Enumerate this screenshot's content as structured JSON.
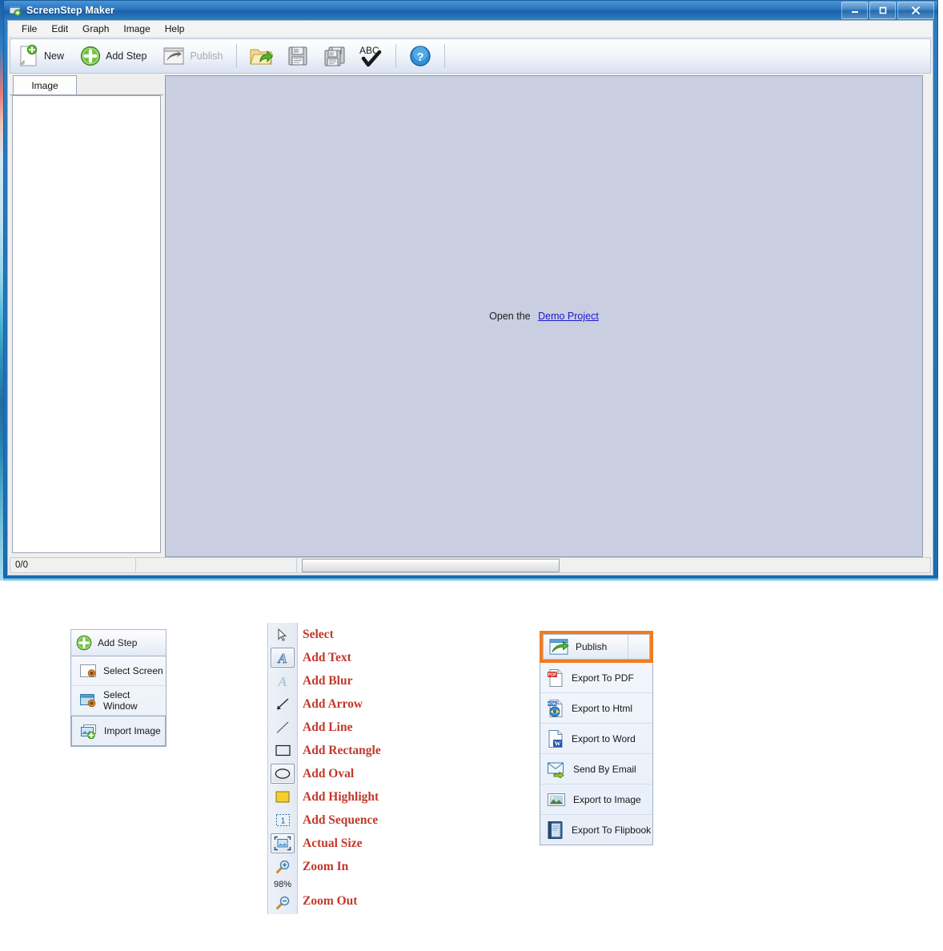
{
  "window": {
    "title": "ScreenStep Maker",
    "icon": "app-window-icon",
    "buttons": {
      "minimize": "–",
      "maximize": "❑",
      "close": "✕"
    }
  },
  "menubar": {
    "items": [
      {
        "label": "File"
      },
      {
        "label": "Edit"
      },
      {
        "label": "Graph"
      },
      {
        "label": "Image"
      },
      {
        "label": "Help"
      }
    ]
  },
  "toolbar": {
    "new_label": "New",
    "add_step_label": "Add Step",
    "publish_label": "Publish",
    "icons": [
      {
        "name": "open-folder-icon"
      },
      {
        "name": "save-icon"
      },
      {
        "name": "save-as-icon"
      },
      {
        "name": "spellcheck-icon",
        "text": "ABC"
      },
      {
        "name": "help-icon",
        "text": "?"
      }
    ]
  },
  "left_pane": {
    "tab_label": "Image"
  },
  "canvas": {
    "message_prefix": "Open the",
    "link_label": "Demo Project"
  },
  "statusbar": {
    "counter": "0/0"
  },
  "callouts": {
    "add_step_menu": {
      "header": "Add Step",
      "header_icon": "green-plus-icon",
      "items": [
        {
          "label": "Select Screen",
          "icon": "select-screen-icon"
        },
        {
          "label": "Select Window",
          "icon": "select-window-icon"
        },
        {
          "label": "Import Image",
          "icon": "import-image-icon"
        }
      ]
    },
    "tools_palette": {
      "zoom_percent": "98%",
      "items": [
        {
          "label": "Select",
          "icon": "cursor-arrow-icon",
          "selected": false
        },
        {
          "label": "Add Text",
          "icon": "text-a-icon",
          "selected": true
        },
        {
          "label": "Add Blur",
          "icon": "blur-a-icon",
          "selected": false
        },
        {
          "label": "Add Arrow",
          "icon": "arrow-icon",
          "selected": false
        },
        {
          "label": "Add Line",
          "icon": "line-icon",
          "selected": false
        },
        {
          "label": "Add Rectangle",
          "icon": "rectangle-icon",
          "selected": false
        },
        {
          "label": "Add Oval",
          "icon": "oval-icon",
          "selected": true
        },
        {
          "label": "Add Highlight",
          "icon": "highlight-square-icon",
          "selected": false
        },
        {
          "label": "Add Sequence",
          "icon": "sequence-number-icon",
          "selected": false
        },
        {
          "label": "Actual Size",
          "icon": "actual-size-icon",
          "selected": true
        },
        {
          "label": "Zoom In",
          "icon": "magnifier-plus-icon",
          "selected": false
        },
        {
          "label": "Zoom Out",
          "icon": "magnifier-minus-icon",
          "selected": false
        }
      ]
    },
    "publish_menu": {
      "header": "Publish",
      "header_icon": "publish-arrow-icon",
      "highlight_color": "#f07c20",
      "items": [
        {
          "label": "Export To PDF",
          "icon": "pdf-file-icon"
        },
        {
          "label": "Export to Html",
          "icon": "html-browser-icon"
        },
        {
          "label": "Export to Word",
          "icon": "word-file-icon"
        },
        {
          "label": "Send By Email",
          "icon": "email-envelope-icon"
        },
        {
          "label": "Export to Image",
          "icon": "picture-icon"
        },
        {
          "label": "Export To Flipbook",
          "icon": "book-icon"
        }
      ]
    }
  },
  "colors": {
    "title_blue": "#2873bb",
    "canvas": "#c9cee0",
    "tool_label_red": "#c0392b",
    "link_blue": "#1919cf",
    "highlight_orange": "#f07c20"
  }
}
